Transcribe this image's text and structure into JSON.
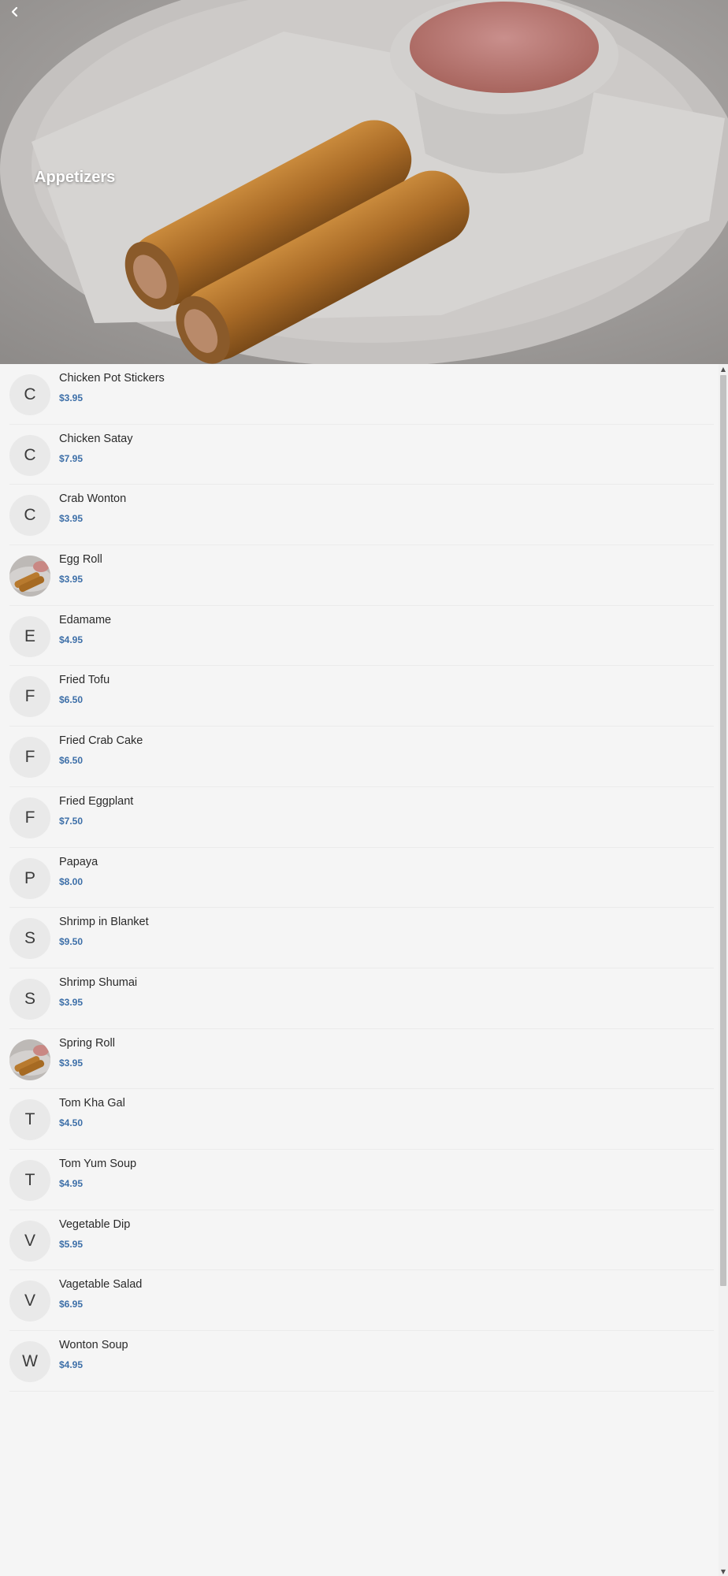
{
  "header": {
    "title": "Appetizers",
    "back_icon": "chevron-left-icon"
  },
  "items": [
    {
      "letter": "C",
      "name": "Chicken Pot Stickers",
      "price": "$3.95",
      "thumbnail": false
    },
    {
      "letter": "C",
      "name": "Chicken Satay",
      "price": "$7.95",
      "thumbnail": false
    },
    {
      "letter": "C",
      "name": "Crab Wonton",
      "price": "$3.95",
      "thumbnail": false
    },
    {
      "letter": "",
      "name": "Egg Roll",
      "price": "$3.95",
      "thumbnail": true
    },
    {
      "letter": "E",
      "name": "Edamame",
      "price": "$4.95",
      "thumbnail": false
    },
    {
      "letter": "F",
      "name": "Fried Tofu",
      "price": "$6.50",
      "thumbnail": false
    },
    {
      "letter": "F",
      "name": "Fried Crab Cake",
      "price": "$6.50",
      "thumbnail": false
    },
    {
      "letter": "F",
      "name": "Fried Eggplant",
      "price": "$7.50",
      "thumbnail": false
    },
    {
      "letter": "P",
      "name": "Papaya",
      "price": "$8.00",
      "thumbnail": false
    },
    {
      "letter": "S",
      "name": "Shrimp in Blanket",
      "price": "$9.50",
      "thumbnail": false
    },
    {
      "letter": "S",
      "name": "Shrimp Shumai",
      "price": "$3.95",
      "thumbnail": false
    },
    {
      "letter": "",
      "name": "Spring Roll",
      "price": "$3.95",
      "thumbnail": true
    },
    {
      "letter": "T",
      "name": "Tom Kha Gal",
      "price": "$4.50",
      "thumbnail": false
    },
    {
      "letter": "T",
      "name": "Tom Yum Soup",
      "price": "$4.95",
      "thumbnail": false
    },
    {
      "letter": "V",
      "name": "Vegetable Dip",
      "price": "$5.95",
      "thumbnail": false
    },
    {
      "letter": "V",
      "name": "Vagetable Salad",
      "price": "$6.95",
      "thumbnail": false
    },
    {
      "letter": "W",
      "name": "Wonton Soup",
      "price": "$4.95",
      "thumbnail": false
    }
  ],
  "colors": {
    "background": "#f5f5f5",
    "price": "#3d6fa8",
    "avatar": "#e9e9e9"
  }
}
